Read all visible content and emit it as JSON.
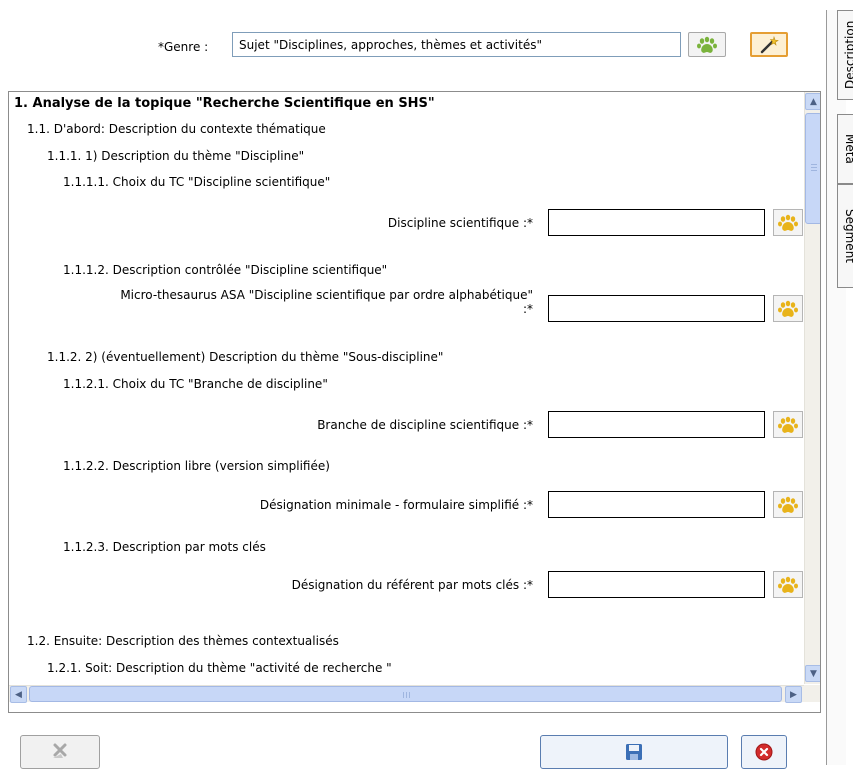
{
  "genre": {
    "label": "*Genre :",
    "value": "Sujet \"Disciplines, approches, thèmes et activités\""
  },
  "tree": {
    "title": "1. Analyse de la topique \"Recherche Scientifique en SHS\"",
    "n1_1": "1.1. D'abord: Description du contexte thématique",
    "n1_1_1": "1.1.1. 1) Description du thème \"Discipline\"",
    "n1_1_1_1": "1.1.1.1. Choix du TC \"Discipline scientifique\"",
    "f1_label": "Discipline scientifique :*",
    "n1_1_1_2": "1.1.1.2. Description contrôlée \"Discipline scientifique\"",
    "f2_label_line1": "Micro-thesaurus ASA \"Discipline scientifique par ordre alphabétique\"",
    "f2_label_line2": ":*",
    "n1_1_2": "1.1.2. 2) (éventuellement) Description du thème \"Sous-discipline\"",
    "n1_1_2_1": "1.1.2.1. Choix du TC \"Branche de discipline\"",
    "f3_label": "Branche de discipline scientifique :*",
    "n1_1_2_2": "1.1.2.2. Description libre (version simplifiée)",
    "f4_label": "Désignation minimale - formulaire simplifié :*",
    "n1_1_2_3": "1.1.2.3. Description par mots clés",
    "f5_label": "Désignation du référent par mots clés :*",
    "n1_2": "1.2. Ensuite: Description des thèmes contextualisés",
    "n1_2_1": "1.2.1. Soit: Description du thème \"activité de recherche \""
  },
  "fields": [
    {
      "value": ""
    },
    {
      "value": ""
    },
    {
      "value": ""
    },
    {
      "value": ""
    },
    {
      "value": ""
    }
  ],
  "side_tabs": {
    "description": "Description",
    "meta": "Méta",
    "segment": "Segment"
  },
  "icons": {
    "paw": "paw-icon",
    "wand": "magic-wand-icon",
    "clear": "clear-icon",
    "save": "save-icon",
    "cancel": "cancel-icon"
  },
  "colors": {
    "paw_yellow": "#e8b31a",
    "paw_green": "#7ab33c",
    "cancel_red": "#d22c2c",
    "save_blue": "#3b6fb6"
  }
}
